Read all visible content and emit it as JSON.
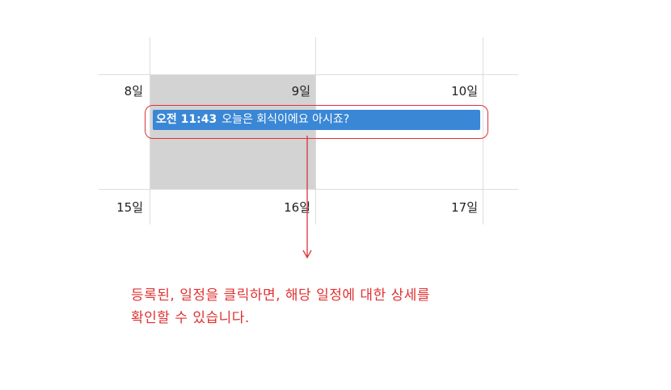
{
  "calendar": {
    "days": [
      {
        "label": "8일"
      },
      {
        "label": "9일"
      },
      {
        "label": "10일"
      },
      {
        "label": "15일"
      },
      {
        "label": "16일"
      },
      {
        "label": "17일"
      }
    ],
    "event": {
      "time": "오전 11:43",
      "title": "오늘은 회식이에요 아시죠?",
      "color": "#3a87d6"
    },
    "today_color": "#d3d3d3"
  },
  "annotation": {
    "line1": "등록된, 일정을 클릭하면, 해당 일정에 대한 상세를",
    "line2": "확인할 수 있습니다.",
    "color": "#e03030"
  }
}
